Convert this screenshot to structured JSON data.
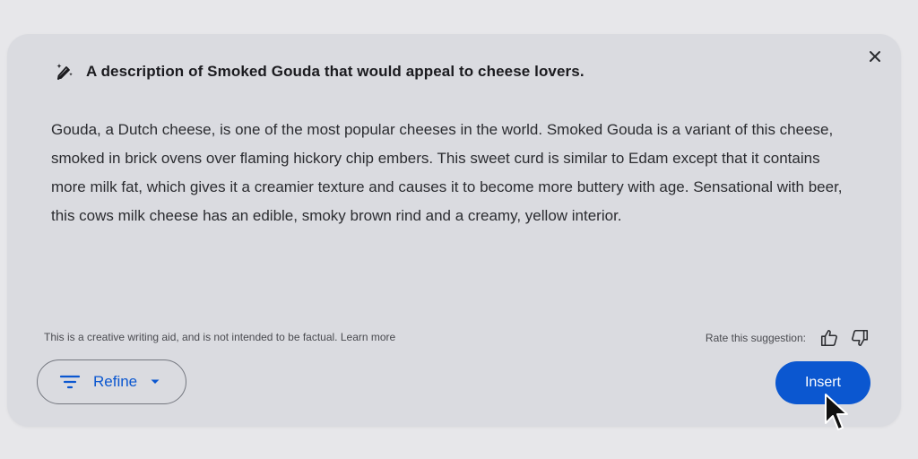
{
  "prompt": {
    "icon": "magic-pen-icon",
    "text": "A description of Smoked Gouda that would appeal to cheese lovers."
  },
  "close": {
    "icon": "close-icon"
  },
  "suggestion": {
    "text": "Gouda, a Dutch cheese, is one of the most popular cheeses in the world. Smoked Gouda is a variant of this cheese, smoked in brick ovens over flaming hickory chip embers. This sweet curd is similar to Edam except that it contains more milk fat, which gives it a creamier texture and causes it to become more buttery with age. Sensational with beer, this cows milk cheese has an edible, smoky brown rind and a creamy, yellow interior."
  },
  "footer": {
    "disclaimer": "This is a creative writing aid, and is not intended to be factual.",
    "learn_more": "Learn more",
    "rate_label": "Rate this suggestion:",
    "thumbs_up_icon": "thumbs-up-icon",
    "thumbs_down_icon": "thumbs-down-icon"
  },
  "actions": {
    "refine_label": "Refine",
    "refine_icon": "filter-lines-icon",
    "refine_dropdown_icon": "caret-down-icon",
    "insert_label": "Insert"
  },
  "colors": {
    "accent": "#0b57d0",
    "card_bg": "#dadbe0",
    "page_bg": "#e7e7ea"
  }
}
